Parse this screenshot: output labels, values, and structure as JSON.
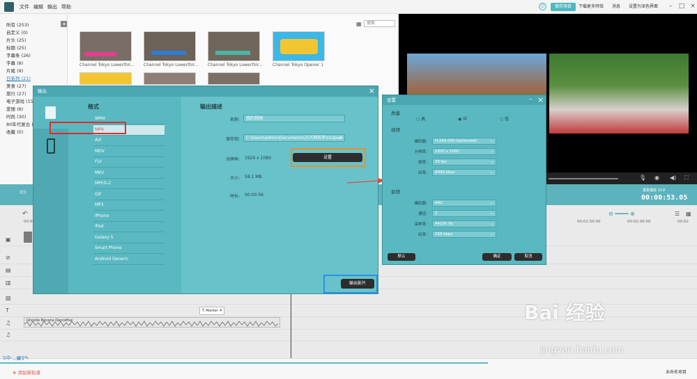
{
  "menu": [
    "文件",
    "编辑",
    "输出",
    "帮助"
  ],
  "topbar": {
    "save_project": "保存项目",
    "download_effects": "下载更多特效",
    "messages": "消息",
    "default_ui": "设置为深色界面"
  },
  "sidebar": {
    "categories": [
      "所有 (253)",
      "自定义 (0)",
      "片头 (25)",
      "标题 (25)",
      "字幕条 (26)",
      "字幕 (8)",
      "片尾 (9)",
      "日系列 (21)",
      "美食 (27)",
      "旅行 (27)",
      "电子游戏 (15)",
      "爱丽 (8)",
      "时尚 (30)",
      "80年代复古 (15)",
      "收藏 (0)"
    ],
    "active": 7
  },
  "media": {
    "search_placeholder": "搜索",
    "thumbs": [
      {
        "caption": "Channel Tokyo Lowerthir...",
        "color": "#7a6d66"
      },
      {
        "caption": "Channel Tokyo Lowerthir...",
        "color": "#6b6258"
      },
      {
        "caption": "Channel Tokyo Lowerthir...",
        "color": "#70665c"
      },
      {
        "caption": "Channel Tokyo Opener 1",
        "color": "#3bb7e8"
      }
    ]
  },
  "preview": {
    "timecode": "00:00:53.05",
    "timecode_label": "重复播放",
    "speed": "10子"
  },
  "timeline": {
    "ruler": [
      "00:00",
      "00:01:50:00",
      "00:02:00:00",
      "00:02"
    ],
    "title_clip": "T Atelier 4",
    "audio_clip": "Ghostie Banana Dancefive",
    "add_track": "添加新轨道",
    "status": "未命名项目"
  },
  "export_dialog": {
    "title": "输出",
    "format_title": "格式",
    "formats": [
      "WMV",
      "MP4",
      "AVI",
      "MOV",
      "FLV",
      "MKV",
      "MPEG-2",
      "GIF",
      "MP3",
      "iPhone",
      "iPad",
      "Galaxy S",
      "Smart Phone",
      "Android Generic"
    ],
    "selected_format": 1,
    "info_title": "输出描述",
    "name_label": "名称:",
    "name_value": "我的视频",
    "path_label": "保存到:",
    "path_value": "C:\\Users\\admin\\Documents\\万兴神剪手\\Output\\",
    "resolution_label": "分辨率:",
    "resolution_value": "1920 x 1080",
    "settings_button": "设置",
    "size_label": "大小:",
    "size_value": "58.1 MB",
    "duration_label": "时长:",
    "duration_value": "00:00:56",
    "export_button": "输出影片"
  },
  "settings_dialog": {
    "title": "设置",
    "quality_title": "质量",
    "quality_options": [
      "高",
      "中",
      "低"
    ],
    "quality_selected": 1,
    "video_title": "视频",
    "video_rows": [
      {
        "label": "编码器:",
        "value": "H.264 (HD Optimized)"
      },
      {
        "label": "分辨率:",
        "value": "1920 x 1080"
      },
      {
        "label": "帧率:",
        "value": "30 fps"
      },
      {
        "label": "码率:",
        "value": "8000 kbps"
      }
    ],
    "audio_title": "音频",
    "audio_rows": [
      {
        "label": "编码器:",
        "value": "AAC"
      },
      {
        "label": "通道:",
        "value": "2"
      },
      {
        "label": "采样率:",
        "value": "44100 Hz"
      },
      {
        "label": "码率:",
        "value": "256 kbps"
      }
    ],
    "default_button": "默认",
    "ok_button": "确定",
    "cancel_button": "取消"
  },
  "watermark": {
    "brand": "Bai  经验",
    "url": "jingyan.baidu.com"
  }
}
